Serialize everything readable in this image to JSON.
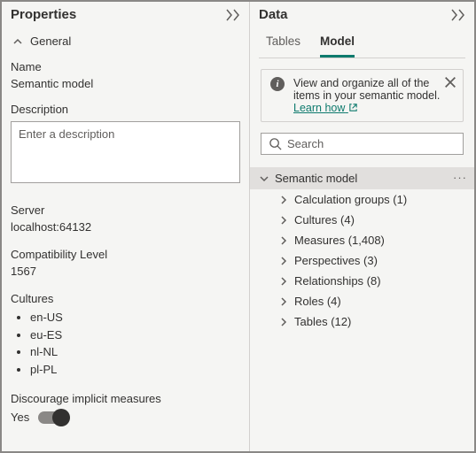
{
  "properties": {
    "title": "Properties",
    "general_label": "General",
    "name_label": "Name",
    "name_value": "Semantic model",
    "description_label": "Description",
    "description_placeholder": "Enter a description",
    "description_value": "",
    "server_label": "Server",
    "server_value": "localhost:64132",
    "compat_label": "Compatibility Level",
    "compat_value": "1567",
    "cultures_label": "Cultures",
    "cultures": [
      "en-US",
      "eu-ES",
      "nl-NL",
      "pl-PL"
    ],
    "discourage_label": "Discourage implicit measures",
    "discourage_value_label": "Yes",
    "discourage_value": true
  },
  "data": {
    "title": "Data",
    "tabs": {
      "tables": "Tables",
      "model": "Model",
      "active": "model"
    },
    "info": {
      "text": "View and organize all of the items in your semantic model.",
      "learn": "Learn how"
    },
    "search_placeholder": "Search",
    "tree": {
      "root": "Semantic model",
      "items": [
        {
          "label": "Calculation groups",
          "count": 1
        },
        {
          "label": "Cultures",
          "count": 4
        },
        {
          "label": "Measures",
          "count": 1408,
          "display": "1,408"
        },
        {
          "label": "Perspectives",
          "count": 3
        },
        {
          "label": "Relationships",
          "count": 8
        },
        {
          "label": "Roles",
          "count": 4
        },
        {
          "label": "Tables",
          "count": 12
        }
      ]
    }
  }
}
